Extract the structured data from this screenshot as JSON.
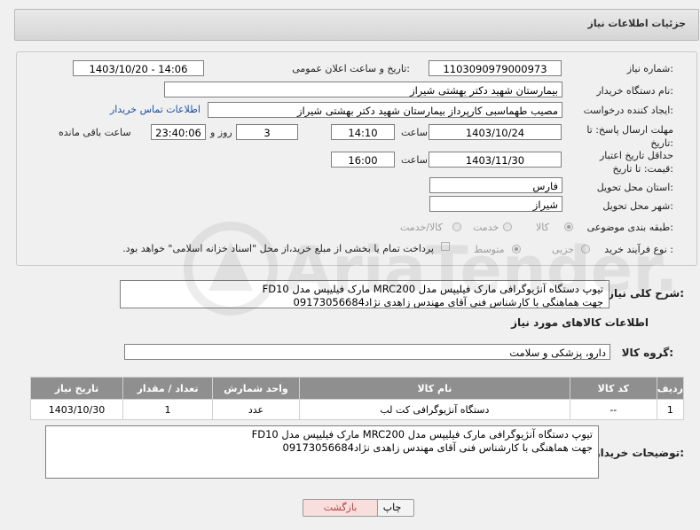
{
  "header": {
    "title": "جزئیات اطلاعات نیاز"
  },
  "form": {
    "need_number_label": "شماره نیاز:",
    "need_number": "1103090979000973",
    "announce_label": "تاریخ و ساعت اعلان عمومی:",
    "announce_value": "1403/10/20 - 14:06",
    "buyer_label": "نام دستگاه خریدار:",
    "buyer_value": "بیمارستان شهید دکتر بهشتی شیراز",
    "creator_label": "ایجاد کننده درخواست:",
    "creator_value": "مصیب طهماسبی کارپرداز بیمارستان شهید دکتر بهشتی شیراز",
    "contact_link": "اطلاعات تماس خریدار",
    "deadline_label": "مهلت ارسال پاسخ: تا تاریخ:",
    "deadline_date": "1403/10/24",
    "time_word": "ساعت",
    "deadline_time": "14:10",
    "days_value": "3",
    "days_word": "روز و",
    "remaining_time": "23:40:06",
    "remaining_word": "ساعت باقی مانده",
    "validity_label": "حداقل تاریخ اعتبار قیمت: تا تاریخ:",
    "validity_date": "1403/11/30",
    "validity_time": "16:00",
    "province_label": "استان محل تحویل:",
    "province_value": "فارس",
    "city_label": "شهر محل تحویل:",
    "city_value": "شیراز",
    "category_label": "طبقه بندی موضوعی:",
    "category_options": [
      "کالا",
      "خدمت",
      "کالا/خدمت"
    ],
    "process_label": "نوع فرآیند خرید :",
    "process_options": [
      "جزیی",
      "متوسط"
    ],
    "payment_text": "پرداخت تمام یا بخشی از مبلغ خرید،از محل \"اسناد خزانه اسلامی\" خواهد بود."
  },
  "description": {
    "label": "شرح کلی نیاز:",
    "line1": "تیوپ دستگاه آنژیوگرافی مارک فیلیپس مدل MRC200 مارک فیلیپس مدل FD10",
    "line2": "جهت هماهنگی با کارشناس فنی آقای مهندس زاهدی نژاد09173056684"
  },
  "goods": {
    "section_title": "اطلاعات کالاهای مورد نیاز",
    "group_label": "گروه کالا:",
    "group_value": "دارو، پزشکی و سلامت",
    "columns": [
      "ردیف",
      "کد کالا",
      "نام کالا",
      "واحد شمارش",
      "تعداد / مقدار",
      "تاریخ نیاز"
    ],
    "rows": [
      [
        "1",
        "--",
        "دستگاه آنژیوگرافی کت لب",
        "عدد",
        "1",
        "1403/10/30"
      ]
    ]
  },
  "buyer_notes": {
    "label": "توضیحات خریدار:",
    "line1": "تیوپ دستگاه آنژیوگرافی مارک فیلیپس مدل MRC200 مارک فیلیپس مدل FD10",
    "line2": "جهت هماهنگی با کارشناس فنی آقای مهندس زاهدی نژاد09173056684"
  },
  "buttons": {
    "print": "چاپ",
    "back": "بازگشت"
  },
  "watermark": {
    "text": "AriaTender.neT"
  },
  "colors": {
    "table_header": "#8f8f8f",
    "back_button": "#f9dede",
    "link": "#1f4fa0"
  }
}
